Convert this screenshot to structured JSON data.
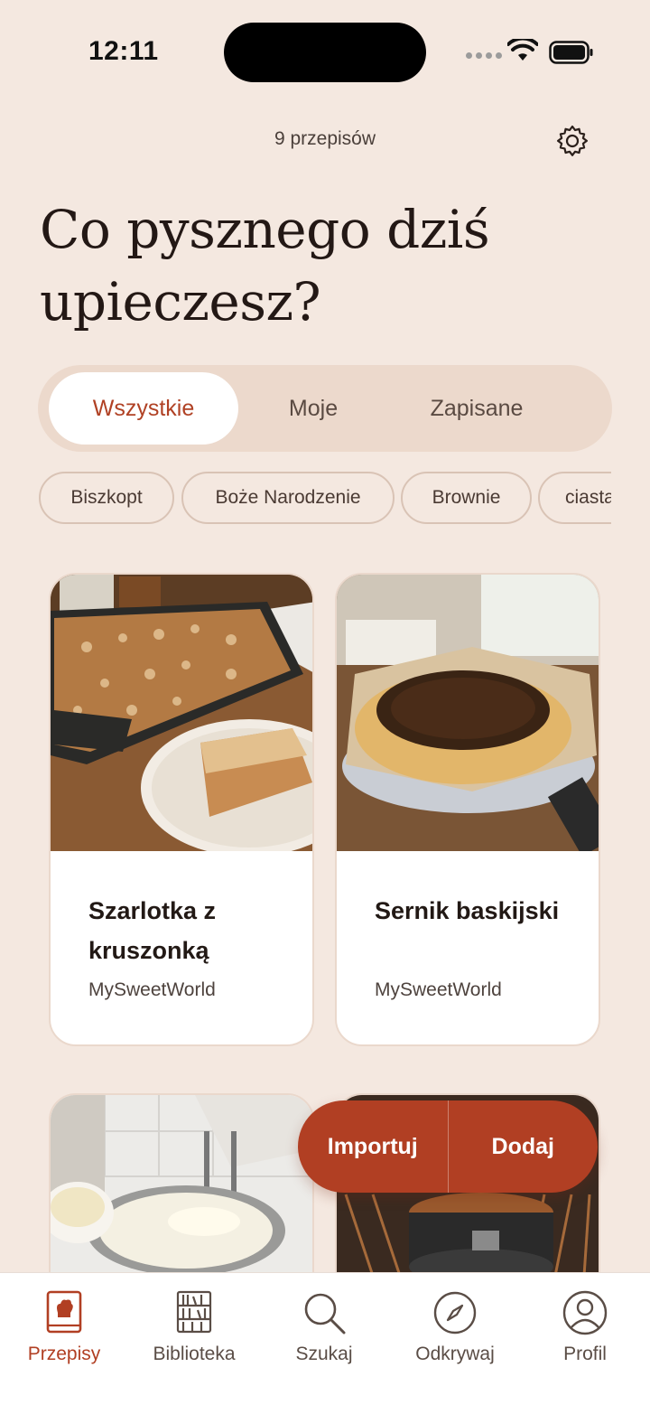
{
  "status_bar": {
    "time": "12:11"
  },
  "header": {
    "recipe_count": "9 przepisów",
    "title": "Co pysznego dziś upieczesz?"
  },
  "segments": [
    {
      "label": "Wszystkie",
      "active": true
    },
    {
      "label": "Moje",
      "active": false
    },
    {
      "label": "Zapisane",
      "active": false
    }
  ],
  "chips": [
    "Biszkopt",
    "Boże Narodzenie",
    "Brownie",
    "ciasta"
  ],
  "recipes": [
    {
      "title": "Szarlotka z kruszonką",
      "author": "MySweetWorld",
      "image": "crumble-cake-photo"
    },
    {
      "title": "Sernik baskijski",
      "author": "MySweetWorld",
      "image": "basque-cheesecake-photo"
    },
    {
      "title": "",
      "author": "",
      "image": "mixer-whipping-cream-photo"
    },
    {
      "title": "",
      "author": "",
      "image": "cake-in-oven-photo"
    }
  ],
  "fab": {
    "import_label": "Importuj",
    "add_label": "Dodaj"
  },
  "tabbar": [
    {
      "label": "Przepisy",
      "icon": "recipe-book-icon",
      "active": true
    },
    {
      "label": "Biblioteka",
      "icon": "bookshelf-icon",
      "active": false
    },
    {
      "label": "Szukaj",
      "icon": "search-icon",
      "active": false
    },
    {
      "label": "Odkrywaj",
      "icon": "compass-icon",
      "active": false
    },
    {
      "label": "Profil",
      "icon": "profile-icon",
      "active": false
    }
  ],
  "colors": {
    "background": "#f4e8e0",
    "accent": "#b13f23",
    "segment_bg": "#ecd9cc"
  }
}
